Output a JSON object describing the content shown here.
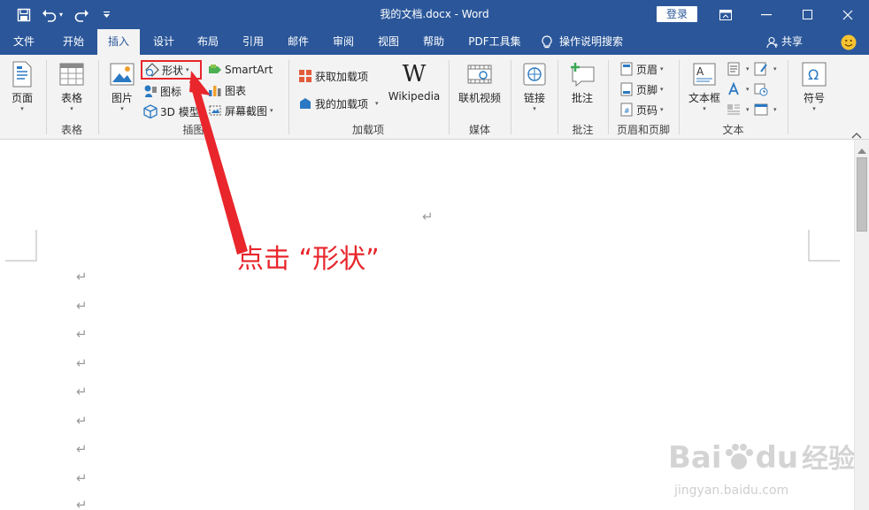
{
  "titlebar": {
    "title": "我的文档.docx  -  Word",
    "login_label": "登录",
    "bg_color": "#2b579a"
  },
  "quick_access": {
    "save_icon": "save-icon",
    "undo_icon": "undo-icon",
    "redo_icon": "redo-icon",
    "customize_icon": "customize-qat-icon"
  },
  "tabs": [
    {
      "label": "文件"
    },
    {
      "label": "开始"
    },
    {
      "label": "插入",
      "active": true
    },
    {
      "label": "设计"
    },
    {
      "label": "布局"
    },
    {
      "label": "引用"
    },
    {
      "label": "邮件"
    },
    {
      "label": "审阅"
    },
    {
      "label": "视图"
    },
    {
      "label": "帮助"
    },
    {
      "label": "PDF工具集"
    }
  ],
  "tell_me": "操作说明搜索",
  "share_label": "共享",
  "ribbon": {
    "pages": {
      "button": "页面",
      "group": ""
    },
    "tables": {
      "button": "表格",
      "group": "表格"
    },
    "illustrations": {
      "group": "插图",
      "picture": "图片",
      "shapes": "形状",
      "icons": "图标",
      "model3d": "3D 模型",
      "smartart": "SmartArt",
      "chart": "图表",
      "screenshot": "屏幕截图"
    },
    "addins": {
      "group": "加载项",
      "get": "获取加载项",
      "my": "我的加载项",
      "wikipedia": "Wikipedia"
    },
    "media": {
      "group": "媒体",
      "video": "联机视频"
    },
    "links": {
      "button": "链接"
    },
    "comments": {
      "group": "批注",
      "button": "批注"
    },
    "header_footer": {
      "group": "页眉和页脚",
      "header": "页眉",
      "footer": "页脚",
      "page_number": "页码"
    },
    "text": {
      "group": "文本",
      "textbox": "文本框"
    },
    "symbols": {
      "button": "符号"
    }
  },
  "document": {
    "para_mark": "↵"
  },
  "annotation": {
    "text": "点击 “形状”",
    "color": "#e8262c"
  },
  "watermark": {
    "brand": "Bai",
    "brand2": "du",
    "cn": "经验",
    "url": "jingyan.baidu.com"
  }
}
